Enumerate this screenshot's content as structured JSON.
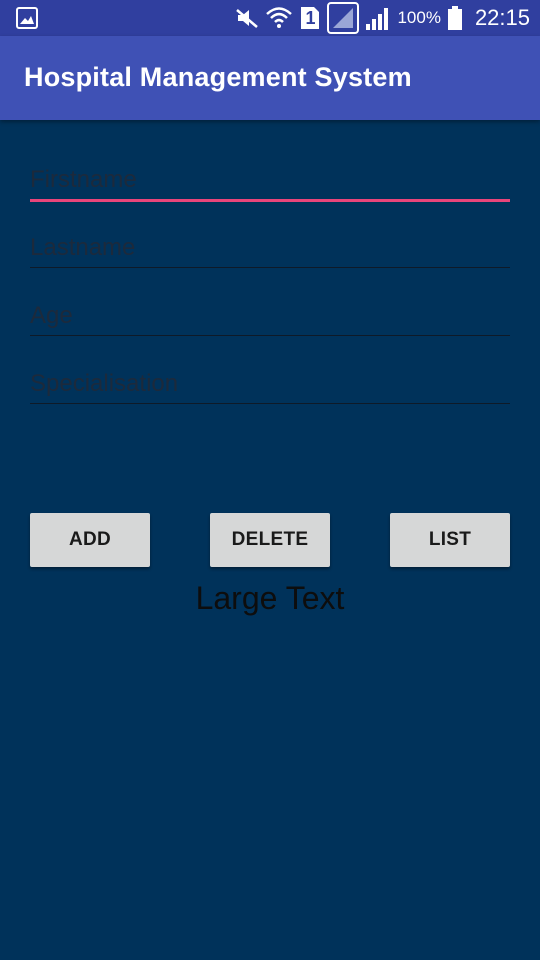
{
  "status_bar": {
    "battery": "100%",
    "time": "22:15",
    "sim_number": "1",
    "icons": [
      "gallery-icon",
      "mute-icon",
      "wifi-icon",
      "sim-icon",
      "no-signal-icon",
      "signal-icon",
      "battery-icon"
    ]
  },
  "app_bar": {
    "title": "Hospital Management System"
  },
  "form": {
    "firstname": {
      "value": "",
      "placeholder": "Firstname"
    },
    "lastname": {
      "value": "",
      "placeholder": "Lastname"
    },
    "age": {
      "value": "",
      "placeholder": "Age"
    },
    "specialisation": {
      "value": "",
      "placeholder": "Specialisation"
    }
  },
  "buttons": {
    "add": "ADD",
    "delete": "DELETE",
    "list": "LIST"
  },
  "large_text": "Large Text",
  "colors": {
    "status_bar": "#303f9f",
    "app_bar": "#3f51b5",
    "background": "#00325a",
    "accent": "#e8457a",
    "button": "#d6d7d7"
  }
}
